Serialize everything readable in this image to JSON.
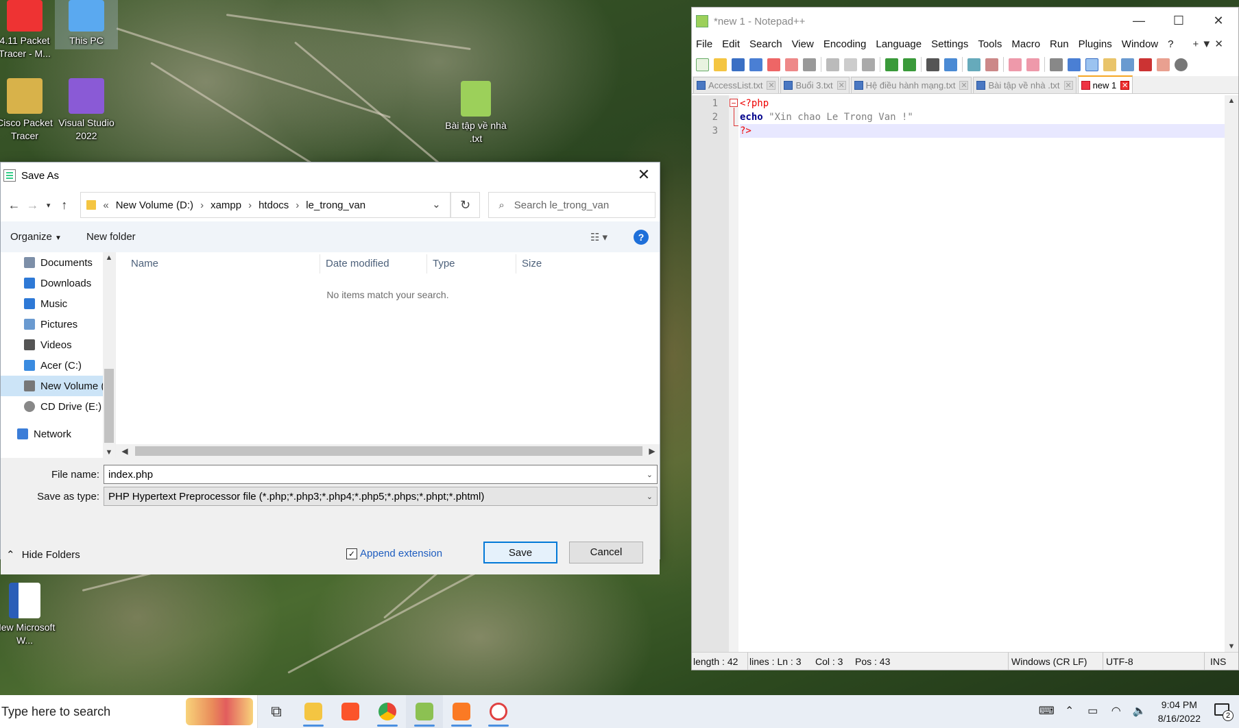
{
  "desktop": {
    "icons": [
      {
        "label": "4.11 Packet Tracer - M...",
        "icon": "packet-tracer-icon"
      },
      {
        "label": "This PC",
        "icon": "this-pc-icon"
      },
      {
        "label": "Cisco Packet Tracer",
        "icon": "cisco-packet-tracer-icon"
      },
      {
        "label": "Visual Studio 2022",
        "icon": "visual-studio-icon"
      },
      {
        "label": "Bài tập về nhà .txt",
        "icon": "notepadpp-file-icon"
      },
      {
        "label": "New Microsoft W...",
        "icon": "word-document-icon"
      }
    ]
  },
  "save_as": {
    "title": "Save As",
    "address": {
      "prefix": "«",
      "crumbs": [
        "New Volume (D:)",
        "xampp",
        "htdocs",
        "le_trong_van"
      ]
    },
    "search_placeholder": "Search le_trong_van",
    "toolbar": {
      "organize": "Organize",
      "new_folder": "New folder",
      "help": "?"
    },
    "nav_items": [
      {
        "label": "Documents",
        "color": "#7d8fa8"
      },
      {
        "label": "Downloads",
        "color": "#2e79d6"
      },
      {
        "label": "Music",
        "color": "#2e79d6"
      },
      {
        "label": "Pictures",
        "color": "#6a9ad0"
      },
      {
        "label": "Videos",
        "color": "#555555"
      },
      {
        "label": "Acer (C:)",
        "color": "#3a8be0"
      },
      {
        "label": "New Volume (D:)",
        "color": "#777777"
      },
      {
        "label": "CD Drive (E:)",
        "color": "#888888"
      }
    ],
    "network": "Network",
    "columns": [
      "Name",
      "Date modified",
      "Type",
      "Size"
    ],
    "empty_message": "No items match your search.",
    "file_name_label": "File name:",
    "file_name_value": "index.php",
    "save_type_label": "Save as type:",
    "save_type_value": "PHP Hypertext Preprocessor file (*.php;*.php3;*.php4;*.php5;*.phps;*.phpt;*.phtml)",
    "hide_folders": "Hide Folders",
    "append_extension": "Append extension",
    "append_checked": true,
    "save_button": "Save",
    "cancel_button": "Cancel"
  },
  "notepad": {
    "title": "*new 1 - Notepad++",
    "menu": [
      "File",
      "Edit",
      "Search",
      "View",
      "Encoding",
      "Language",
      "Settings",
      "Tools",
      "Macro",
      "Run",
      "Plugins",
      "Window",
      "?"
    ],
    "menu_right": "+ ▼ ✕",
    "tabs": [
      {
        "label": "AccessList.txt",
        "active": false
      },
      {
        "label": "Buổi 3.txt",
        "active": false
      },
      {
        "label": "Hệ điều hành mạng.txt",
        "active": false
      },
      {
        "label": "Bài tập về nhà .txt",
        "active": false
      },
      {
        "label": "new 1",
        "active": true
      }
    ],
    "line_numbers": [
      "1",
      "2",
      "3"
    ],
    "code": {
      "line1": "<?php",
      "line2_kw": "echo",
      "line2_str": " \"Xin chao Le Trong Van !\"",
      "line3": "?>"
    },
    "status": {
      "length": "length : 42",
      "lines": "lines : Ln : 3",
      "col": "Col : 3",
      "pos": "Pos : 43",
      "eol": "Windows (CR LF)",
      "encoding": "UTF-8",
      "mode": "INS"
    }
  },
  "taskbar": {
    "search_placeholder": "Type here to search",
    "apps": [
      {
        "name": "task-view-icon",
        "color": "#333333"
      },
      {
        "name": "file-explorer-icon",
        "color": "#f4c542"
      },
      {
        "name": "brave-browser-icon",
        "color": "#fb542b"
      },
      {
        "name": "chrome-icon",
        "color": "#34a853"
      },
      {
        "name": "notepadpp-icon",
        "color": "#8cc152"
      },
      {
        "name": "xampp-icon",
        "color": "#fb7a24"
      },
      {
        "name": "packet-tracer-taskbar-icon",
        "color": "#e04040"
      }
    ],
    "time": "9:04 PM",
    "date": "8/16/2022",
    "notification_count": "2"
  }
}
